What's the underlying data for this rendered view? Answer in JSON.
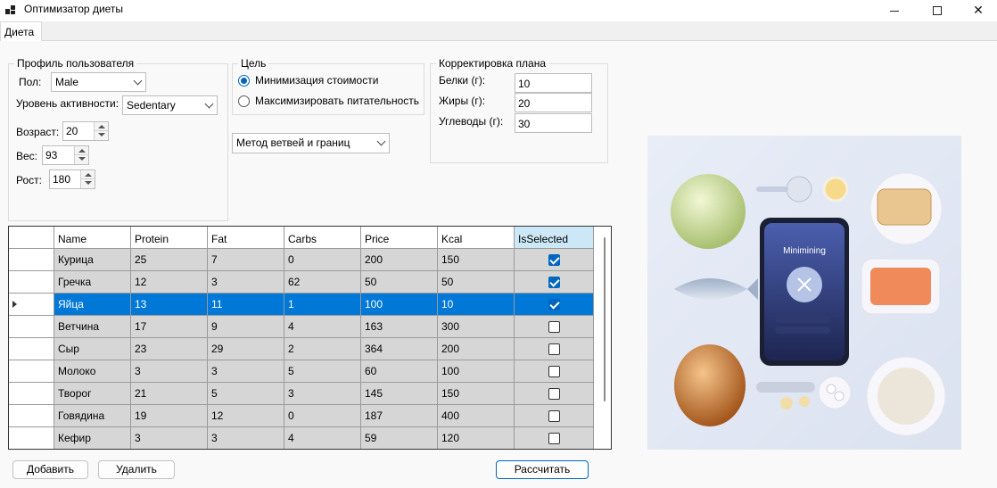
{
  "window": {
    "title": "Оптимизатор диеты"
  },
  "tabs": [
    {
      "label": "Диета"
    }
  ],
  "profile": {
    "title": "Профиль пользователя",
    "gender_label": "Пол:",
    "gender_value": "Male",
    "activity_label": "Уровень активности:",
    "activity_value": "Sedentary",
    "age_label": "Возраст:",
    "age_value": "20",
    "weight_label": "Вес:",
    "weight_value": "93",
    "height_label": "Рост:",
    "height_value": "180"
  },
  "goal": {
    "title": "Цель",
    "options": [
      {
        "label": "Минимизация стоимости",
        "selected": true
      },
      {
        "label": "Максимизировать питательность",
        "selected": false
      }
    ]
  },
  "method": {
    "value": "Метод ветвей и границ"
  },
  "plan": {
    "title": "Корректировка плана",
    "protein_label": "Белки (г):",
    "protein_value": "10",
    "fat_label": "Жиры (г):",
    "fat_value": "20",
    "carbs_label": "Углеводы (г):",
    "carbs_value": "30"
  },
  "grid": {
    "columns": [
      "Name",
      "Protein",
      "Fat",
      "Carbs",
      "Price",
      "Kcal",
      "IsSelected"
    ],
    "rows": [
      {
        "name": "Курица",
        "protein": "25",
        "fat": "7",
        "carbs": "0",
        "price": "200",
        "kcal": "150",
        "selected": true
      },
      {
        "name": "Гречка",
        "protein": "12",
        "fat": "3",
        "carbs": "62",
        "price": "50",
        "kcal": "50",
        "selected": true
      },
      {
        "name": "Яйца",
        "protein": "13",
        "fat": "11",
        "carbs": "1",
        "price": "100",
        "kcal": "10",
        "selected": true
      },
      {
        "name": "Ветчина",
        "protein": "17",
        "fat": "9",
        "carbs": "4",
        "price": "163",
        "kcal": "300",
        "selected": false
      },
      {
        "name": "Сыр",
        "protein": "23",
        "fat": "29",
        "carbs": "2",
        "price": "364",
        "kcal": "200",
        "selected": false
      },
      {
        "name": "Молоко",
        "protein": "3",
        "fat": "3",
        "carbs": "5",
        "price": "60",
        "kcal": "100",
        "selected": false
      },
      {
        "name": "Творог",
        "protein": "21",
        "fat": "5",
        "carbs": "3",
        "price": "145",
        "kcal": "150",
        "selected": false
      },
      {
        "name": "Говядина",
        "protein": "19",
        "fat": "12",
        "carbs": "0",
        "price": "187",
        "kcal": "400",
        "selected": false
      },
      {
        "name": "Кефир",
        "protein": "3",
        "fat": "3",
        "carbs": "4",
        "price": "59",
        "kcal": "120",
        "selected": false
      }
    ]
  },
  "buttons": {
    "add": "Добавить",
    "delete": "Удалить",
    "calculate": "Рассчитать"
  },
  "illustration": {
    "phone_text": "Minimining"
  }
}
